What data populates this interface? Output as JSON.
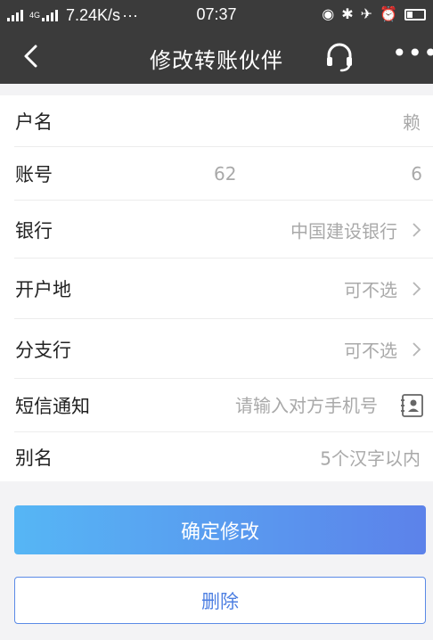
{
  "status_bar": {
    "net_type": "4G",
    "speed": "7.24K/s",
    "dots": "···",
    "time": "07:37",
    "icons": [
      "location-icon",
      "bluetooth-icon",
      "mute-icon",
      "alarm-icon",
      "battery-icon"
    ],
    "battery_level": 0.3
  },
  "nav": {
    "title": "修改转账伙伴",
    "more_label": "•••"
  },
  "form": {
    "rows": [
      {
        "label": "户名",
        "value": "赖"
      },
      {
        "label": "账号",
        "value_start": "62",
        "value_end": "6"
      },
      {
        "label": "银行",
        "value": "中国建设银行"
      },
      {
        "label": "开户地",
        "value": "可不选"
      },
      {
        "label": "分支行",
        "value": "可不选"
      },
      {
        "label": "短信通知",
        "placeholder": "请输入对方手机号"
      },
      {
        "label": "别名",
        "value": "5个汉字以内"
      }
    ]
  },
  "actions": {
    "confirm_label": "确定修改",
    "delete_label": "删除"
  },
  "colors": {
    "header_bg": "#3b3b3b",
    "accent": "#5a8ae6",
    "gradient_start": "#56b6f5",
    "gradient_end": "#5c82ea"
  }
}
